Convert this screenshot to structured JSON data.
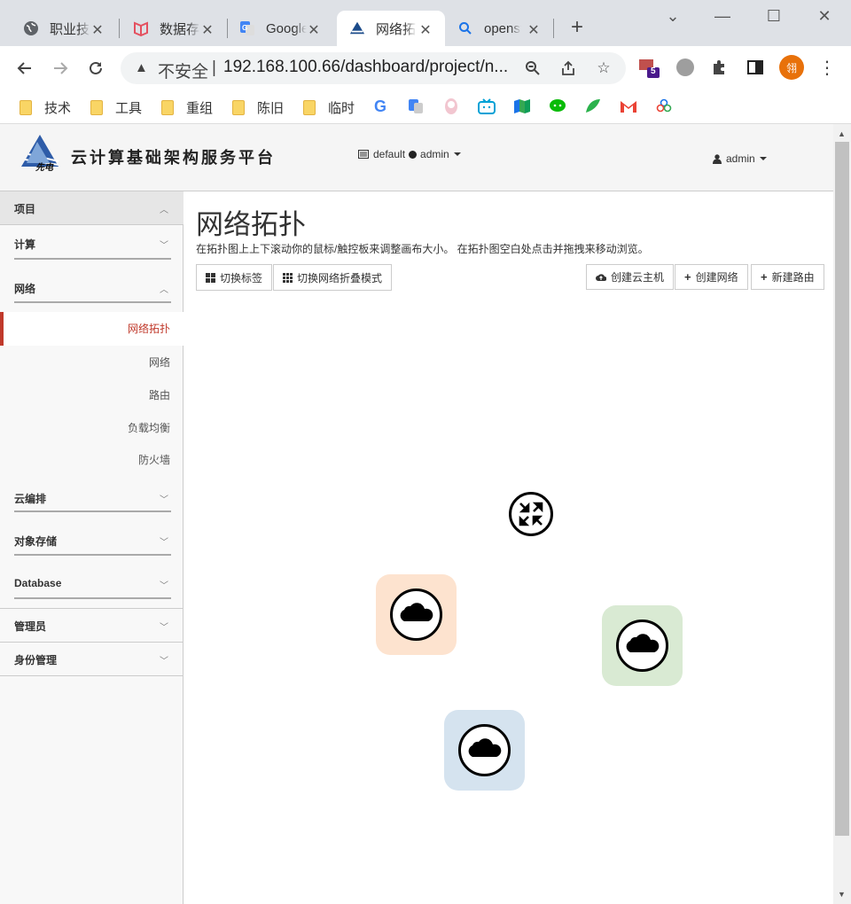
{
  "browser": {
    "tabs": [
      {
        "title": "职业技能",
        "icon": "globe-icon"
      },
      {
        "title": "数据存储",
        "icon": "book-icon"
      },
      {
        "title": "Google",
        "icon": "translate-icon"
      },
      {
        "title": "网络拓扑",
        "icon": "openstack-icon"
      },
      {
        "title": "openstack",
        "icon": "search-icon"
      }
    ],
    "active_tab": 3,
    "address": {
      "security_label": "不安全",
      "separator": "|",
      "url": "192.168.100.66/dashboard/project/n..."
    },
    "extension_badge": "5",
    "profile_initial": "翎",
    "bookmarks": [
      {
        "label": "技术"
      },
      {
        "label": "工具"
      },
      {
        "label": "重组"
      },
      {
        "label": "陈旧"
      },
      {
        "label": "临时"
      }
    ]
  },
  "header": {
    "brand": "云计算基础架构服务平台",
    "logo_text": "先电",
    "project": "default",
    "project_user": "admin",
    "user": "admin"
  },
  "sidebar": {
    "project": "项目",
    "compute": "计算",
    "network": "网络",
    "network_items": [
      "网络拓扑",
      "网络",
      "路由",
      "负载均衡",
      "防火墙"
    ],
    "orchestration": "云编排",
    "object_store": "对象存储",
    "database": "Database",
    "admin": "管理员",
    "identity": "身份管理"
  },
  "main": {
    "title": "网络拓扑",
    "description": "在拓扑图上上下滚动你的鼠标/触控板来调整画布大小。 在拓扑图空白处点击并拖拽来移动浏览。",
    "toggle_labels": "切换标签",
    "toggle_collapse": "切换网络折叠模式",
    "create_instance": "创建云主机",
    "create_network": "创建网络",
    "create_router": "新建路由"
  },
  "topology": {
    "router": {
      "icon": "router-icon"
    },
    "networks": [
      {
        "icon": "cloud-icon",
        "color": "#fde3cf"
      },
      {
        "icon": "cloud-icon",
        "color": "#d9ead3"
      },
      {
        "icon": "cloud-icon",
        "color": "#d5e3ef"
      }
    ]
  }
}
